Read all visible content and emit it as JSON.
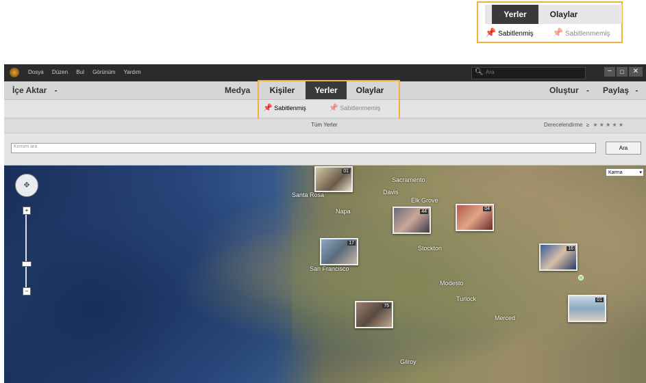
{
  "callout": {
    "tabs": [
      "Yerler",
      "Olaylar"
    ],
    "pinned": "Sabitlenmiş",
    "unpinned": "Sabitlenmemiş"
  },
  "titlebar": {
    "menus": [
      "Dosya",
      "Düzen",
      "Bul",
      "Görünüm",
      "Yardım"
    ],
    "search_placeholder": "Ara"
  },
  "menubar": {
    "import": "İçe Aktar",
    "media": "Medya",
    "tabs": [
      "Kişiler",
      "Yerler",
      "Olaylar"
    ],
    "create": "Oluştur",
    "share": "Paylaş"
  },
  "subbar": {
    "pinned": "Sabitlenmiş",
    "unpinned": "Sabitlenmemiş"
  },
  "filterbar": {
    "all_places": "Tüm Yerler",
    "rating_label": "Derecelendirme",
    "rating_op": "≥",
    "stars": "★ ★ ★ ★ ★"
  },
  "search": {
    "placeholder": "Konum ara",
    "button": "Ara"
  },
  "map": {
    "type_select": "Karma",
    "cities": [
      "Sacramento",
      "Santa Rosa",
      "Davis",
      "Elk Grove",
      "Napa",
      "San Francisco",
      "Stockton",
      "Modesto",
      "Turlock",
      "Merced",
      "Gilroy"
    ],
    "photo_counts": [
      "01",
      "44",
      "04",
      "17",
      "16",
      "75",
      "01"
    ]
  },
  "colors": {
    "accent_orange": "#f2b23a",
    "active_tab": "#3a3a3a"
  }
}
